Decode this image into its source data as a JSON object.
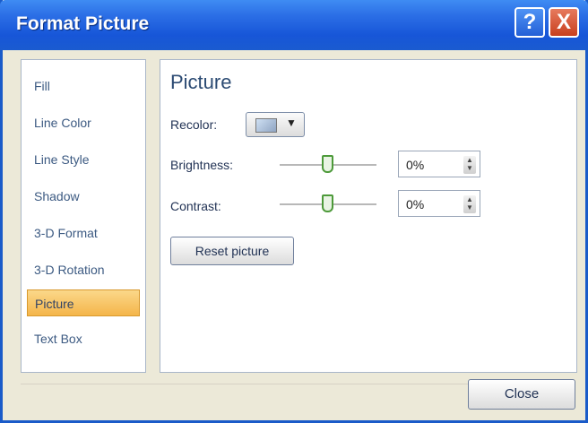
{
  "window": {
    "title": "Format Picture",
    "help_label": "?",
    "close_label": "X"
  },
  "sidebar": {
    "items": [
      {
        "label": "Fill"
      },
      {
        "label": "Line Color"
      },
      {
        "label": "Line Style"
      },
      {
        "label": "Shadow"
      },
      {
        "label": "3-D Format"
      },
      {
        "label": "3-D Rotation"
      },
      {
        "label": "Picture",
        "active": true
      },
      {
        "label": "Text Box"
      }
    ]
  },
  "picture": {
    "section_title": "Picture",
    "recolor_label": "Recolor:",
    "recolor_arrow": "▼",
    "brightness_label": "Brightness:",
    "brightness_value": "0%",
    "contrast_label": "Contrast:",
    "contrast_value": "0%",
    "reset_label": "Reset picture",
    "spin_up": "▲",
    "spin_down": "▼"
  },
  "footer": {
    "close_label": "Close"
  }
}
